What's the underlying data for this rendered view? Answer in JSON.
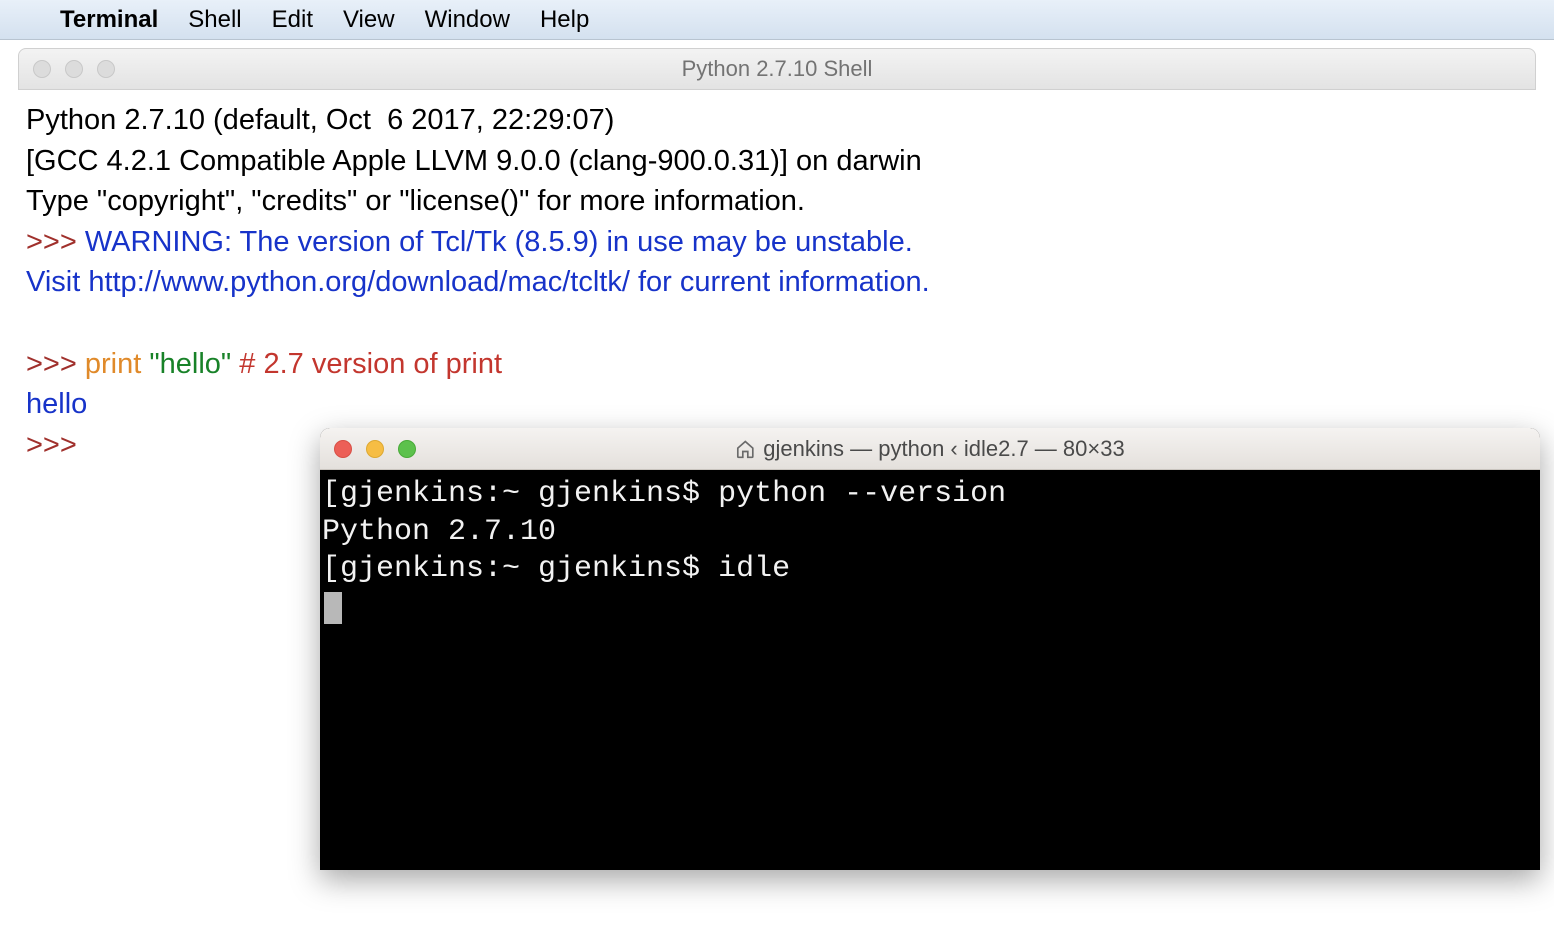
{
  "menubar": {
    "app_name": "Terminal",
    "items": [
      "Shell",
      "Edit",
      "View",
      "Window",
      "Help"
    ]
  },
  "idle": {
    "title": "Python 2.7.10 Shell",
    "banner_line1": "Python 2.7.10 (default, Oct  6 2017, 22:29:07) ",
    "banner_line2": "[GCC 4.2.1 Compatible Apple LLVM 9.0.0 (clang-900.0.31)] on darwin",
    "banner_line3": "Type \"copyright\", \"credits\" or \"license()\" for more information.",
    "prompt1": ">>> ",
    "warn_line1": "WARNING: The version of Tcl/Tk (8.5.9) in use may be unstable.",
    "warn_line2": "Visit http://www.python.org/download/mac/tcltk/ for current information.",
    "prompt2": ">>> ",
    "kw_print": "print",
    "space1": " ",
    "str_hello": "\"hello\"",
    "space2": " ",
    "comment": "# 2.7 version of print",
    "output_hello": "hello",
    "prompt3": ">>> "
  },
  "terminal": {
    "title": "gjenkins — python ‹ idle2.7 — 80×33",
    "line1_prompt": "[gjenkins:~ gjenkins$ ",
    "line1_cmd": "python --version",
    "line2": "Python 2.7.10",
    "line3_prompt": "[gjenkins:~ gjenkins$ ",
    "line3_cmd": "idle"
  }
}
